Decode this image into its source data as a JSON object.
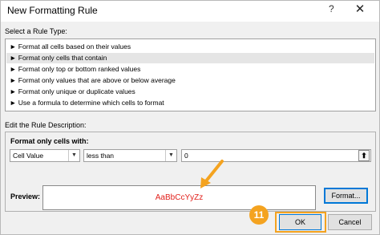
{
  "window": {
    "title": "New Formatting Rule",
    "help_glyph": "?",
    "close_glyph": "✕"
  },
  "rule_type": {
    "heading": "Select a Rule Type:",
    "items": [
      "► Format all cells based on their values",
      "► Format only cells that contain",
      "► Format only top or bottom ranked values",
      "► Format only values that are above or below average",
      "► Format only unique or duplicate values",
      "► Use a formula to determine which cells to format"
    ],
    "selected_index": 1
  },
  "description": {
    "heading": "Edit the Rule Description:",
    "format_only_label": "Format only cells with:",
    "condition_type": {
      "value": "Cell Value",
      "arrow": "▼"
    },
    "operator": {
      "value": "less than",
      "arrow": "▼"
    },
    "value_input": "0",
    "collapse_glyph": "⬆",
    "preview_label": "Preview:",
    "preview_text": "AaBbCcYyZz",
    "format_button": "Format..."
  },
  "buttons": {
    "ok": "OK",
    "cancel": "Cancel"
  },
  "annotation": {
    "step_number": "11",
    "color": "#f4a320"
  },
  "colors": {
    "preview_text": "#e2211c",
    "focus_blue": "#0078d7",
    "selected_row": "#e5e5e5"
  }
}
